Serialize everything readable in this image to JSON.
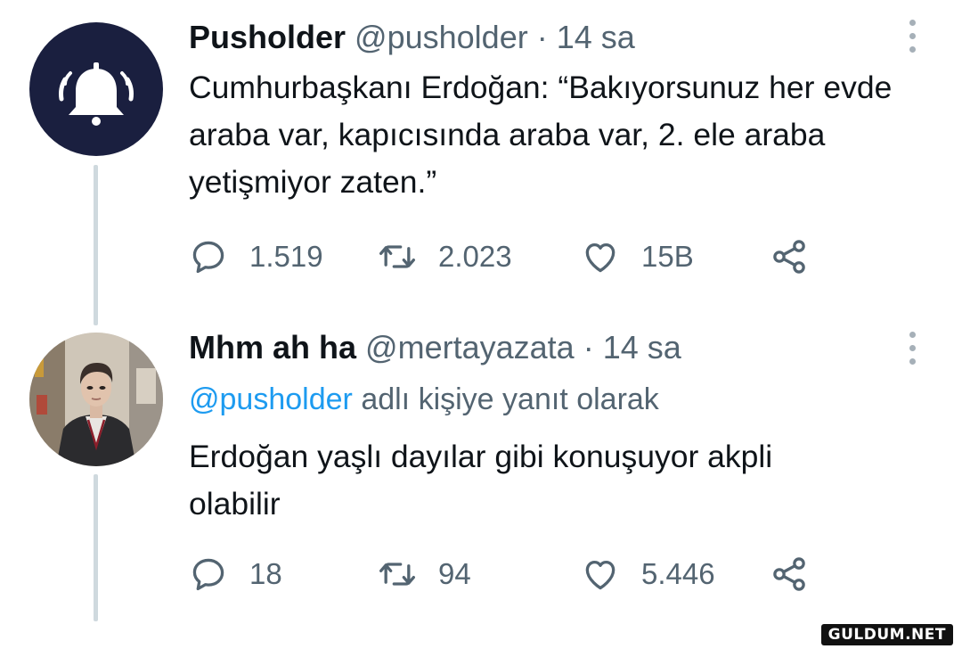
{
  "tweets": [
    {
      "name": "Pusholder",
      "handle": "@pusholder",
      "separator": "·",
      "time": "14 sa",
      "avatar_icon": "bell-icon",
      "text": "Cumhurbaşkanı Erdoğan: “Bakıyorsunuz her evde araba var, kapıcısında araba var, 2. ele araba yetişmiyor zaten.”",
      "replies": "1.519",
      "retweets": "2.023",
      "likes": "15B"
    },
    {
      "name": "Mhm ah ha",
      "handle": "@mertayazata",
      "separator": "·",
      "time": "14 sa",
      "avatar_icon": "profile-photo",
      "reply_to_mention": "@pusholder",
      "reply_to_suffix": "adlı kişiye yanıt olarak",
      "text": "Erdoğan yaşlı dayılar gibi konuşuyor akpli olabilir",
      "replies": "18",
      "retweets": "94",
      "likes": "5.446"
    }
  ],
  "watermark": "GULDUM.NET",
  "colors": {
    "text_primary": "#0f1419",
    "text_secondary": "#536471",
    "mention": "#1d9bf0",
    "bell_avatar_bg": "#1a1f3f",
    "thread_line": "#cfd9de"
  }
}
